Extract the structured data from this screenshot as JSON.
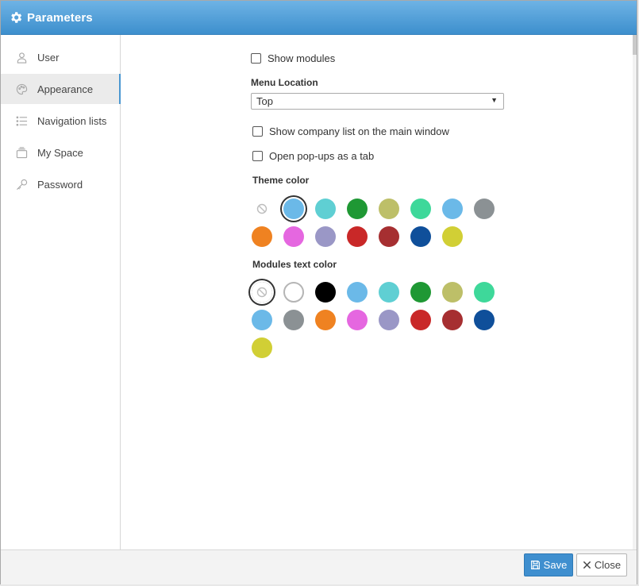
{
  "window": {
    "title": "Parameters"
  },
  "sidebar": {
    "items": [
      {
        "label": "User",
        "icon": "user-icon",
        "active": false
      },
      {
        "label": "Appearance",
        "icon": "palette-icon",
        "active": true
      },
      {
        "label": "Navigation lists",
        "icon": "list-icon",
        "active": false
      },
      {
        "label": "My Space",
        "icon": "tray-icon",
        "active": false
      },
      {
        "label": "Password",
        "icon": "key-icon",
        "active": false
      }
    ]
  },
  "appearance": {
    "show_modules": {
      "label": "Show modules",
      "checked": false
    },
    "menu_location": {
      "label": "Menu Location",
      "value": "Top"
    },
    "show_company_list": {
      "label": "Show company list on the main window",
      "checked": false
    },
    "popups_as_tab": {
      "label": "Open pop-ups as a tab",
      "checked": false
    },
    "theme_color": {
      "label": "Theme color",
      "selected_index": 1,
      "swatches": [
        "none",
        "#6bb9e8",
        "#5fcfd3",
        "#1f9834",
        "#bdbf68",
        "#3ed89a",
        "#6bb9e8",
        "#8b9194",
        "#ef8221",
        "#e567e0",
        "#9a97c6",
        "#c92828",
        "#a62f31",
        "#0f4f9a",
        "#d1cf35"
      ]
    },
    "modules_text_color": {
      "label": "Modules text color",
      "selected_index": 0,
      "swatches": [
        "none",
        "#ffffff",
        "#000000",
        "#6bb9e8",
        "#5fcfd3",
        "#1f9834",
        "#bdbf68",
        "#3ed89a",
        "#6bb9e8",
        "#8b9194",
        "#ef8221",
        "#e567e0",
        "#9a97c6",
        "#c92828",
        "#a62f31",
        "#0f4f9a",
        "#d1cf35"
      ]
    }
  },
  "footer": {
    "save_label": "Save",
    "close_label": "Close"
  }
}
